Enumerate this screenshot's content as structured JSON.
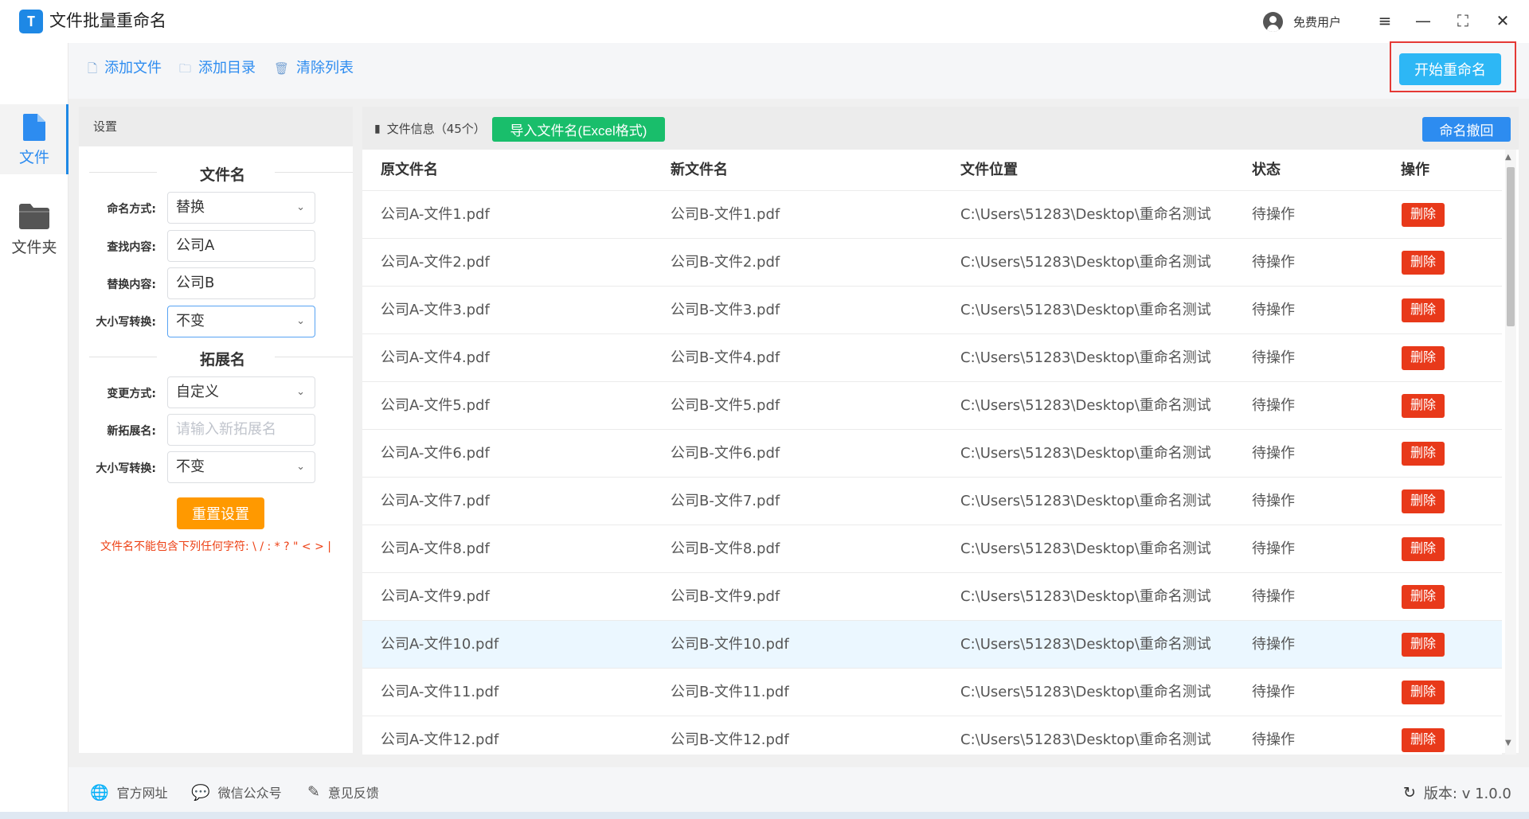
{
  "app": {
    "title": "文件批量重命名",
    "logo_text": "T",
    "user_label": "免费用户"
  },
  "window": {
    "menu": "≡",
    "minimize": "—",
    "maximize": "⛶",
    "close": "✕"
  },
  "nav": {
    "files_label": "文件",
    "folder_label": "文件夹"
  },
  "toolbar": {
    "add_files": "添加文件",
    "add_folder": "添加目录",
    "clear_list": "清除列表",
    "start_rename": "开始重命名"
  },
  "settings": {
    "title": "设置",
    "filename_section": "文件名",
    "naming_mode_label": "命名方式:",
    "naming_mode_value": "替换",
    "find_label": "查找内容:",
    "find_value": "公司A",
    "replace_label": "替换内容:",
    "replace_value": "公司B",
    "case_label": "大小写转换:",
    "case_value": "不变",
    "ext_section": "拓展名",
    "ext_mode_label": "变更方式:",
    "ext_mode_value": "自定义",
    "new_ext_label": "新拓展名:",
    "new_ext_placeholder": "请输入新拓展名",
    "ext_case_label": "大小写转换:",
    "ext_case_value": "不变",
    "reset_button": "重置设置",
    "warning": "文件名不能包含下列任何字符: \\ / : * ? \" < > |"
  },
  "filelist": {
    "info": "文件信息（45个）",
    "import_button": "导入文件名(Excel格式)",
    "undo_button": "命名撤回",
    "columns": [
      "原文件名",
      "新文件名",
      "文件位置",
      "状态",
      "操作"
    ],
    "delete_label": "删除",
    "rows": [
      {
        "original": "公司A-文件1.pdf",
        "new": "公司B-文件1.pdf",
        "location": "C:\\Users\\51283\\Desktop\\重命名测试",
        "status": "待操作"
      },
      {
        "original": "公司A-文件2.pdf",
        "new": "公司B-文件2.pdf",
        "location": "C:\\Users\\51283\\Desktop\\重命名测试",
        "status": "待操作"
      },
      {
        "original": "公司A-文件3.pdf",
        "new": "公司B-文件3.pdf",
        "location": "C:\\Users\\51283\\Desktop\\重命名测试",
        "status": "待操作"
      },
      {
        "original": "公司A-文件4.pdf",
        "new": "公司B-文件4.pdf",
        "location": "C:\\Users\\51283\\Desktop\\重命名测试",
        "status": "待操作"
      },
      {
        "original": "公司A-文件5.pdf",
        "new": "公司B-文件5.pdf",
        "location": "C:\\Users\\51283\\Desktop\\重命名测试",
        "status": "待操作"
      },
      {
        "original": "公司A-文件6.pdf",
        "new": "公司B-文件6.pdf",
        "location": "C:\\Users\\51283\\Desktop\\重命名测试",
        "status": "待操作"
      },
      {
        "original": "公司A-文件7.pdf",
        "new": "公司B-文件7.pdf",
        "location": "C:\\Users\\51283\\Desktop\\重命名测试",
        "status": "待操作"
      },
      {
        "original": "公司A-文件8.pdf",
        "new": "公司B-文件8.pdf",
        "location": "C:\\Users\\51283\\Desktop\\重命名测试",
        "status": "待操作"
      },
      {
        "original": "公司A-文件9.pdf",
        "new": "公司B-文件9.pdf",
        "location": "C:\\Users\\51283\\Desktop\\重命名测试",
        "status": "待操作"
      },
      {
        "original": "公司A-文件10.pdf",
        "new": "公司B-文件10.pdf",
        "location": "C:\\Users\\51283\\Desktop\\重命名测试",
        "status": "待操作"
      },
      {
        "original": "公司A-文件11.pdf",
        "new": "公司B-文件11.pdf",
        "location": "C:\\Users\\51283\\Desktop\\重命名测试",
        "status": "待操作"
      },
      {
        "original": "公司A-文件12.pdf",
        "new": "公司B-文件12.pdf",
        "location": "C:\\Users\\51283\\Desktop\\重命名测试",
        "status": "待操作"
      }
    ]
  },
  "footer": {
    "website": "官方网址",
    "wechat": "微信公众号",
    "feedback": "意见反馈",
    "version": "版本: v 1.0.0"
  },
  "colors": {
    "accent": "#2d8cf0",
    "start_button": "#2db7f5",
    "import_button": "#19be6b",
    "delete_button": "#e8391a",
    "reset_button": "#ff9900",
    "highlight_border": "#e53935"
  }
}
